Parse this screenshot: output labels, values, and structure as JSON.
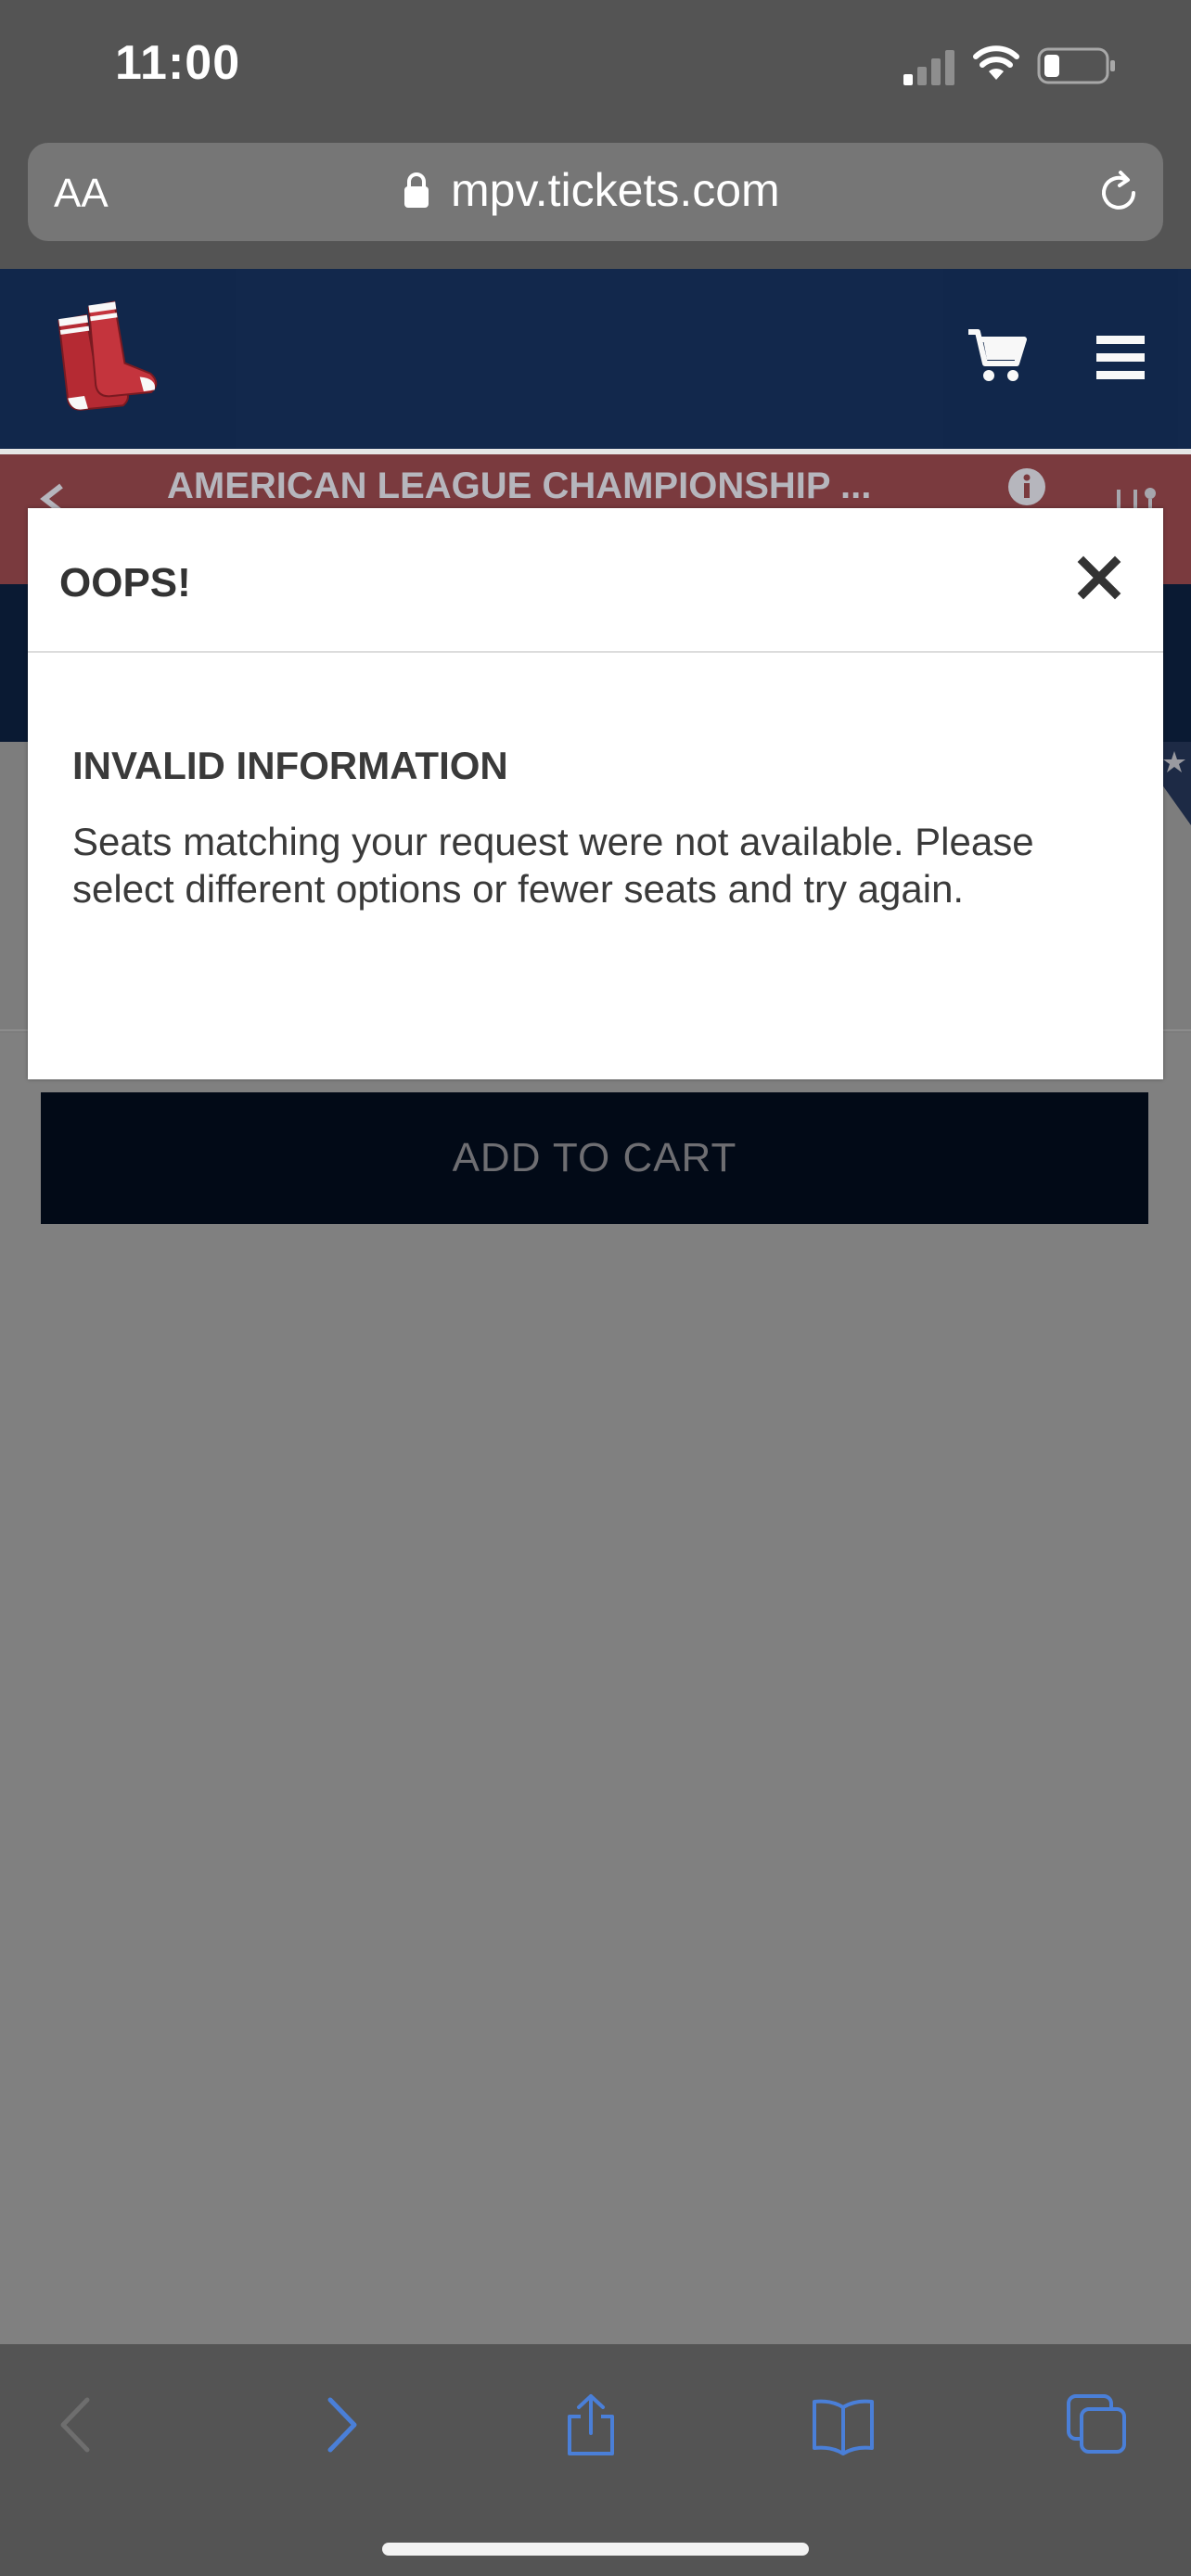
{
  "status_bar": {
    "time": "11:00"
  },
  "browser": {
    "text_size_label": "AA",
    "url": "mpv.tickets.com"
  },
  "event": {
    "title": "AMERICAN LEAGUE CHAMPIONSHIP ..."
  },
  "modal": {
    "title": "OOPS!",
    "heading": "INVALID INFORMATION",
    "message": "Seats matching your request were not available. Please select different options or fewer seats and try again."
  },
  "actions": {
    "add_to_cart_label": "ADD TO CART"
  },
  "colors": {
    "header_navy": "#0c2349",
    "banner_red": "#7a3a3e",
    "overlay_gray": "#808080",
    "toolbar_blue_icon": "#4a7fd8"
  },
  "icons": {
    "cart": "cart-icon",
    "menu": "hamburger-menu-icon",
    "close": "close-icon",
    "info": "info-icon"
  }
}
